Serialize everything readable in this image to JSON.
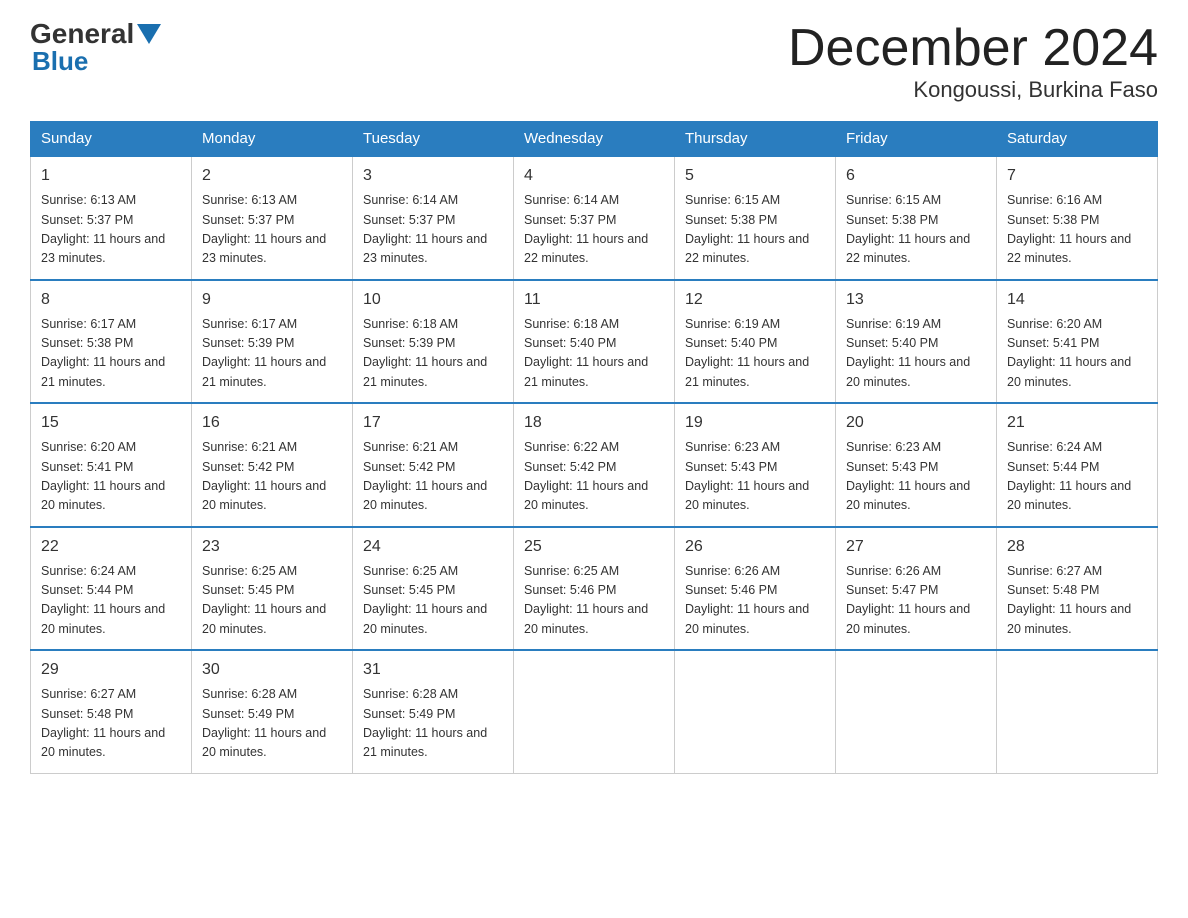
{
  "logo": {
    "general": "General",
    "blue": "Blue"
  },
  "title": {
    "month": "December 2024",
    "location": "Kongoussi, Burkina Faso"
  },
  "weekdays": [
    "Sunday",
    "Monday",
    "Tuesday",
    "Wednesday",
    "Thursday",
    "Friday",
    "Saturday"
  ],
  "weeks": [
    [
      {
        "day": "1",
        "sunrise": "6:13 AM",
        "sunset": "5:37 PM",
        "daylight": "11 hours and 23 minutes."
      },
      {
        "day": "2",
        "sunrise": "6:13 AM",
        "sunset": "5:37 PM",
        "daylight": "11 hours and 23 minutes."
      },
      {
        "day": "3",
        "sunrise": "6:14 AM",
        "sunset": "5:37 PM",
        "daylight": "11 hours and 23 minutes."
      },
      {
        "day": "4",
        "sunrise": "6:14 AM",
        "sunset": "5:37 PM",
        "daylight": "11 hours and 22 minutes."
      },
      {
        "day": "5",
        "sunrise": "6:15 AM",
        "sunset": "5:38 PM",
        "daylight": "11 hours and 22 minutes."
      },
      {
        "day": "6",
        "sunrise": "6:15 AM",
        "sunset": "5:38 PM",
        "daylight": "11 hours and 22 minutes."
      },
      {
        "day": "7",
        "sunrise": "6:16 AM",
        "sunset": "5:38 PM",
        "daylight": "11 hours and 22 minutes."
      }
    ],
    [
      {
        "day": "8",
        "sunrise": "6:17 AM",
        "sunset": "5:38 PM",
        "daylight": "11 hours and 21 minutes."
      },
      {
        "day": "9",
        "sunrise": "6:17 AM",
        "sunset": "5:39 PM",
        "daylight": "11 hours and 21 minutes."
      },
      {
        "day": "10",
        "sunrise": "6:18 AM",
        "sunset": "5:39 PM",
        "daylight": "11 hours and 21 minutes."
      },
      {
        "day": "11",
        "sunrise": "6:18 AM",
        "sunset": "5:40 PM",
        "daylight": "11 hours and 21 minutes."
      },
      {
        "day": "12",
        "sunrise": "6:19 AM",
        "sunset": "5:40 PM",
        "daylight": "11 hours and 21 minutes."
      },
      {
        "day": "13",
        "sunrise": "6:19 AM",
        "sunset": "5:40 PM",
        "daylight": "11 hours and 20 minutes."
      },
      {
        "day": "14",
        "sunrise": "6:20 AM",
        "sunset": "5:41 PM",
        "daylight": "11 hours and 20 minutes."
      }
    ],
    [
      {
        "day": "15",
        "sunrise": "6:20 AM",
        "sunset": "5:41 PM",
        "daylight": "11 hours and 20 minutes."
      },
      {
        "day": "16",
        "sunrise": "6:21 AM",
        "sunset": "5:42 PM",
        "daylight": "11 hours and 20 minutes."
      },
      {
        "day": "17",
        "sunrise": "6:21 AM",
        "sunset": "5:42 PM",
        "daylight": "11 hours and 20 minutes."
      },
      {
        "day": "18",
        "sunrise": "6:22 AM",
        "sunset": "5:42 PM",
        "daylight": "11 hours and 20 minutes."
      },
      {
        "day": "19",
        "sunrise": "6:23 AM",
        "sunset": "5:43 PM",
        "daylight": "11 hours and 20 minutes."
      },
      {
        "day": "20",
        "sunrise": "6:23 AM",
        "sunset": "5:43 PM",
        "daylight": "11 hours and 20 minutes."
      },
      {
        "day": "21",
        "sunrise": "6:24 AM",
        "sunset": "5:44 PM",
        "daylight": "11 hours and 20 minutes."
      }
    ],
    [
      {
        "day": "22",
        "sunrise": "6:24 AM",
        "sunset": "5:44 PM",
        "daylight": "11 hours and 20 minutes."
      },
      {
        "day": "23",
        "sunrise": "6:25 AM",
        "sunset": "5:45 PM",
        "daylight": "11 hours and 20 minutes."
      },
      {
        "day": "24",
        "sunrise": "6:25 AM",
        "sunset": "5:45 PM",
        "daylight": "11 hours and 20 minutes."
      },
      {
        "day": "25",
        "sunrise": "6:25 AM",
        "sunset": "5:46 PM",
        "daylight": "11 hours and 20 minutes."
      },
      {
        "day": "26",
        "sunrise": "6:26 AM",
        "sunset": "5:46 PM",
        "daylight": "11 hours and 20 minutes."
      },
      {
        "day": "27",
        "sunrise": "6:26 AM",
        "sunset": "5:47 PM",
        "daylight": "11 hours and 20 minutes."
      },
      {
        "day": "28",
        "sunrise": "6:27 AM",
        "sunset": "5:48 PM",
        "daylight": "11 hours and 20 minutes."
      }
    ],
    [
      {
        "day": "29",
        "sunrise": "6:27 AM",
        "sunset": "5:48 PM",
        "daylight": "11 hours and 20 minutes."
      },
      {
        "day": "30",
        "sunrise": "6:28 AM",
        "sunset": "5:49 PM",
        "daylight": "11 hours and 20 minutes."
      },
      {
        "day": "31",
        "sunrise": "6:28 AM",
        "sunset": "5:49 PM",
        "daylight": "11 hours and 21 minutes."
      },
      null,
      null,
      null,
      null
    ]
  ],
  "labels": {
    "sunrise": "Sunrise:",
    "sunset": "Sunset:",
    "daylight": "Daylight:"
  }
}
